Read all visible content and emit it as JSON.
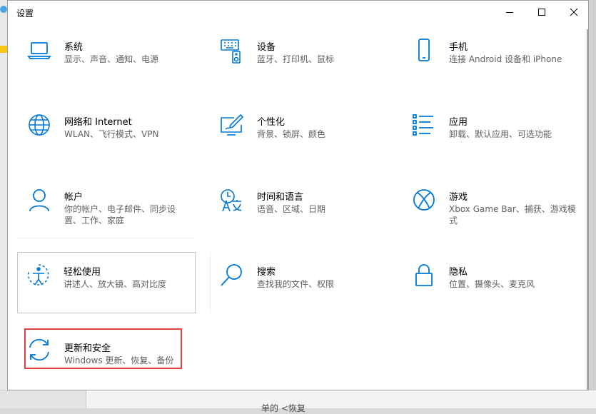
{
  "window": {
    "title": "设置"
  },
  "background": {
    "snippet": "单的 <恢复"
  },
  "tiles": [
    {
      "key": "system",
      "name": "系统",
      "desc": "显示、声音、通知、电源",
      "icon": "laptop-icon"
    },
    {
      "key": "devices",
      "name": "设备",
      "desc": "蓝牙、打印机、鼠标",
      "icon": "keyboard-speaker-icon"
    },
    {
      "key": "phone",
      "name": "手机",
      "desc": "连接 Android 设备和 iPhone",
      "icon": "phone-icon"
    },
    {
      "key": "network",
      "name": "网络和 Internet",
      "desc": "WLAN、飞行模式、VPN",
      "icon": "globe-icon"
    },
    {
      "key": "personalization",
      "name": "个性化",
      "desc": "背景、锁屏、颜色",
      "icon": "paint-monitor-icon"
    },
    {
      "key": "apps",
      "name": "应用",
      "desc": "卸载、默认应用、可选功能",
      "icon": "app-list-icon"
    },
    {
      "key": "accounts",
      "name": "帐户",
      "desc": "你的帐户、电子邮件、同步设置、工作、家庭",
      "icon": "person-icon"
    },
    {
      "key": "time_language",
      "name": "时间和语言",
      "desc": "语音、区域、日期",
      "icon": "time-language-icon"
    },
    {
      "key": "gaming",
      "name": "游戏",
      "desc": "Xbox Game Bar、捕获、游戏模式",
      "icon": "xbox-icon"
    },
    {
      "key": "ease_of_access",
      "name": "轻松使用",
      "desc": "讲述人、放大镜、高对比度",
      "icon": "ease-of-access-icon"
    },
    {
      "key": "search",
      "name": "搜索",
      "desc": "查找我的文件、权限",
      "icon": "search-icon"
    },
    {
      "key": "privacy",
      "name": "隐私",
      "desc": "位置、摄像头、麦克风",
      "icon": "lock-icon"
    },
    {
      "key": "update_security",
      "name": "更新和安全",
      "desc": "Windows 更新、恢复、备份",
      "icon": "refresh-icon"
    }
  ],
  "colors": {
    "accent": "#0078d7",
    "highlight_box": "#e04040",
    "desc_text": "#606060"
  }
}
